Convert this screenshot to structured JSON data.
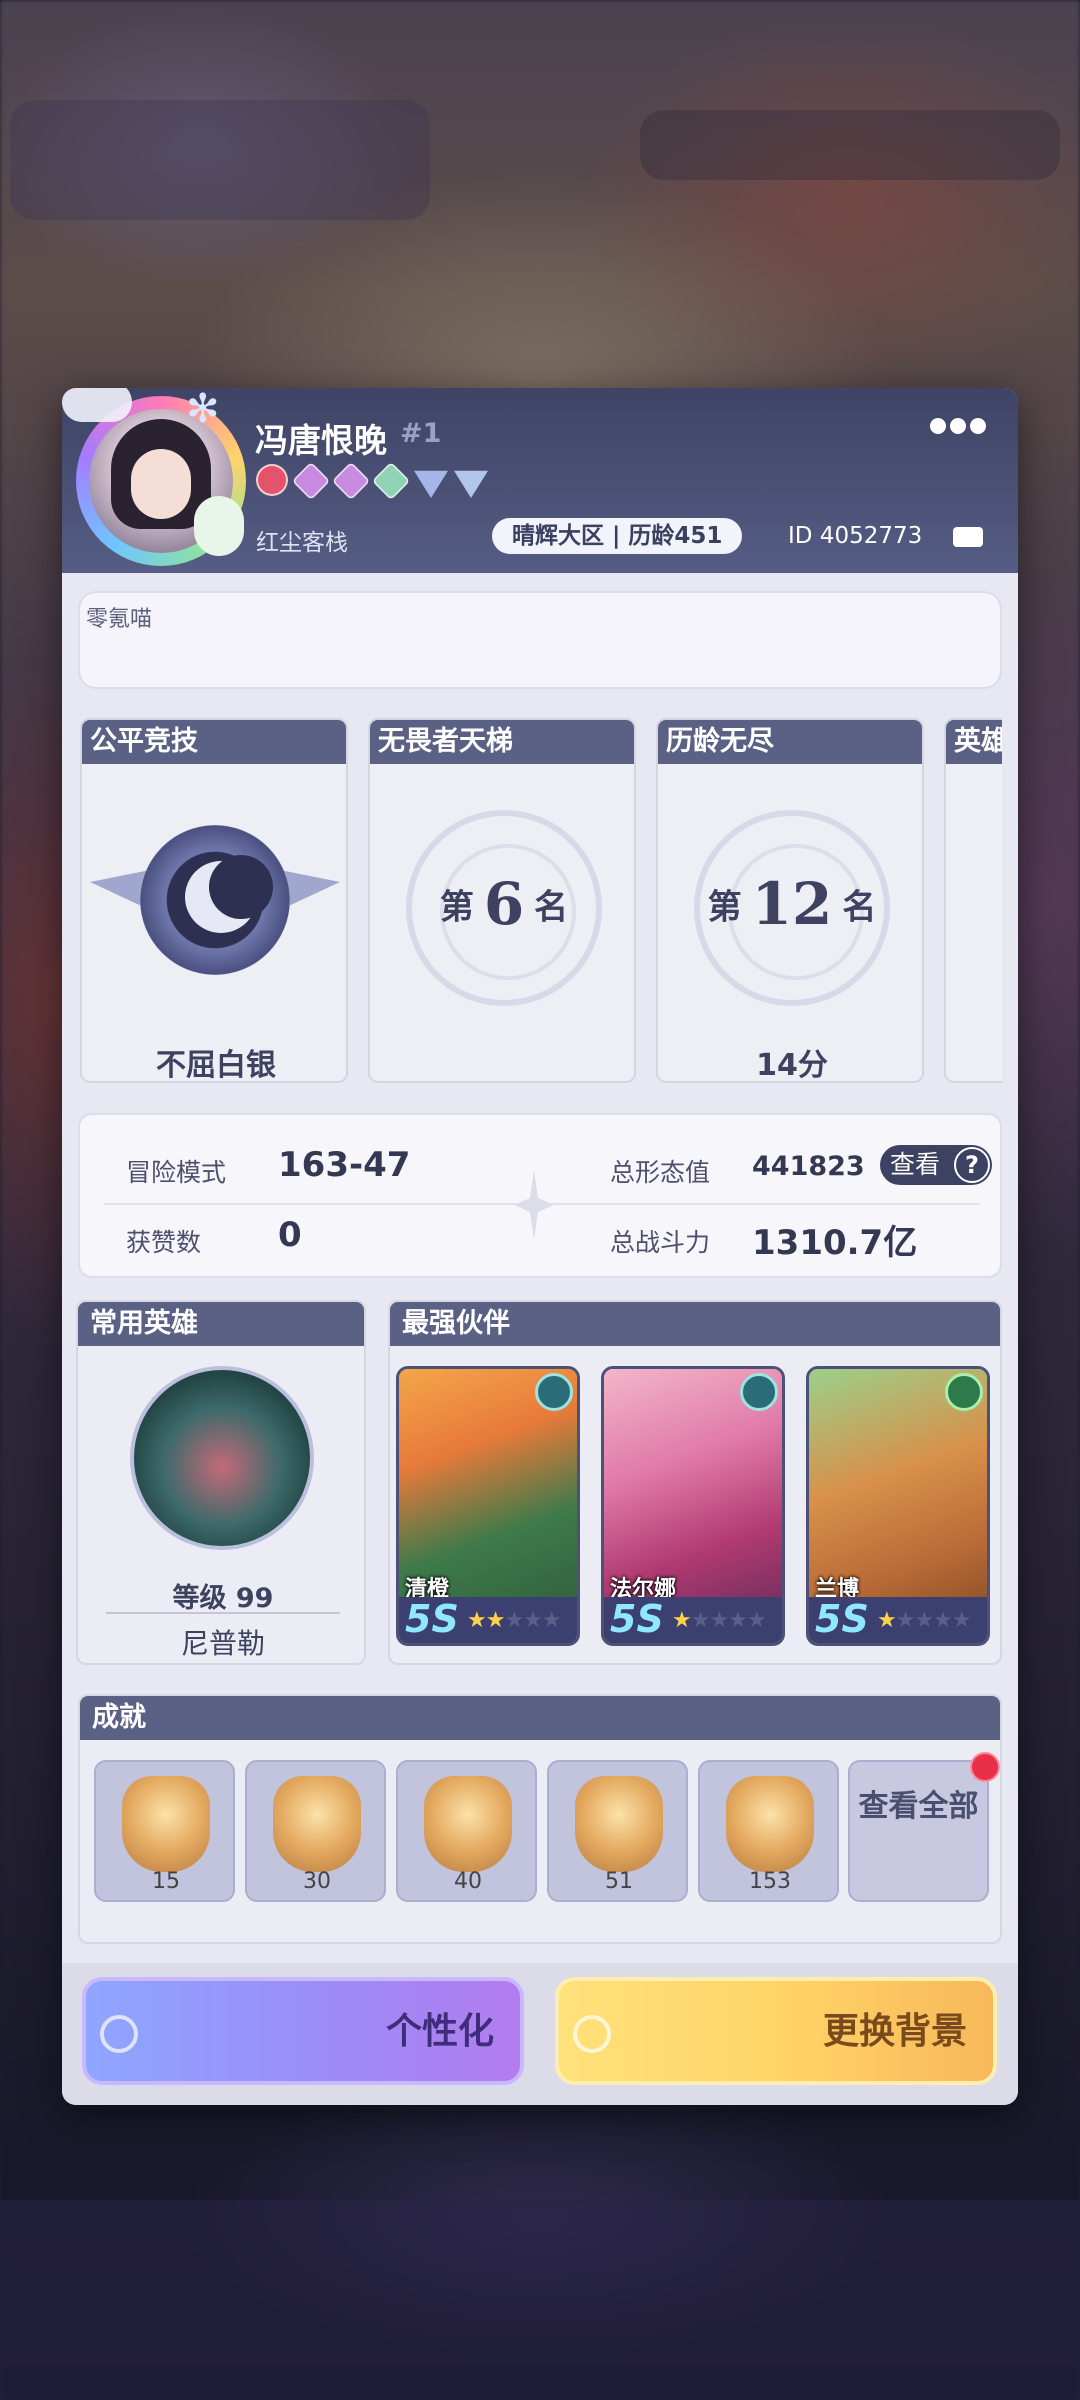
{
  "player": {
    "name": "冯唐恨晚",
    "rank_tag": "#1",
    "guild": "红尘客栈",
    "server_pill": "晴辉大区 | 历龄451",
    "id_text": "ID 4052773",
    "signature": "零氪喵"
  },
  "rank_cards": [
    {
      "title": "公平竞技",
      "sub": "不屈白银"
    },
    {
      "title": "无畏者天梯",
      "prefix": "第",
      "rank": "6",
      "suffix": "名",
      "sub": ""
    },
    {
      "title": "历龄无尽",
      "prefix": "第",
      "rank": "12",
      "suffix": "名",
      "sub": "14分"
    },
    {
      "title": "英雄"
    }
  ],
  "stats": {
    "adventure_label": "冒险模式",
    "adventure_value": "163-47",
    "likes_label": "获赞数",
    "likes_value": "0",
    "form_label": "总形态值",
    "form_value": "441823",
    "power_label": "总战斗力",
    "power_value": "1310.7亿",
    "view_label": "查看",
    "help_icon": "?"
  },
  "common_hero": {
    "title": "常用英雄",
    "level": "等级 99",
    "name": "尼普勒"
  },
  "partners": {
    "title": "最强伙伴",
    "items": [
      {
        "name": "清橙",
        "grade": "5S",
        "stars_on": "★★",
        "stars_off": "★★★"
      },
      {
        "name": "法尔娜",
        "grade": "5S",
        "stars_on": "★",
        "stars_off": "★★★★"
      },
      {
        "name": "兰博",
        "grade": "5S",
        "stars_on": "★",
        "stars_off": "★★★★"
      }
    ]
  },
  "achievements": {
    "title": "成就",
    "items": [
      "15",
      "30",
      "40",
      "51",
      "153"
    ],
    "view_all": "查看全部"
  },
  "buttons": {
    "personalize": "个性化",
    "change_background": "更换背景"
  }
}
